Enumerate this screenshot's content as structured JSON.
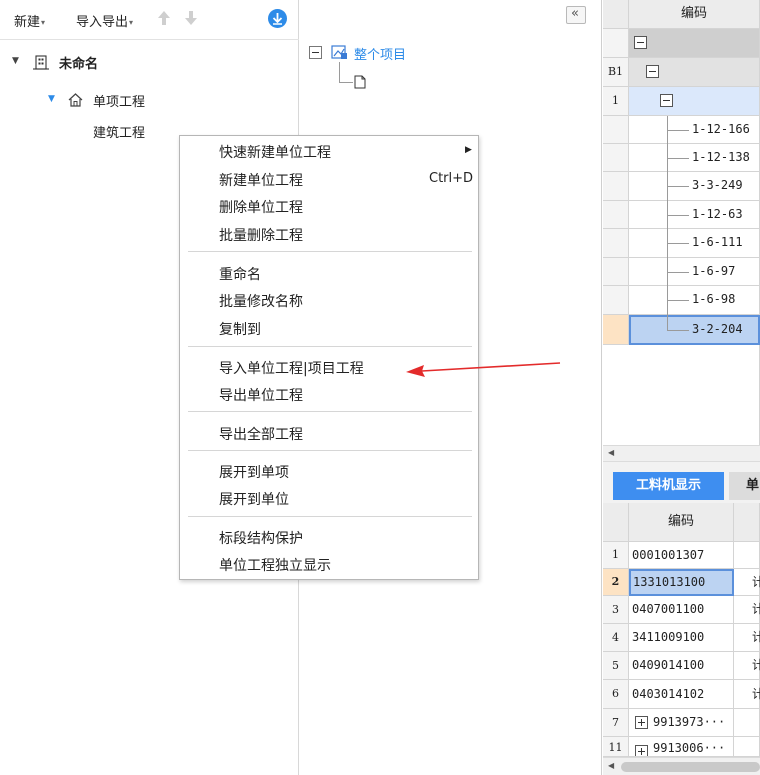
{
  "toolbar": {
    "new_label": "新建",
    "import_export_label": "导入导出"
  },
  "tree": {
    "root_label": "未命名",
    "project_label": "单项工程",
    "unit_label": "建筑工程"
  },
  "middle": {
    "whole_project_label": "整个项目",
    "collapse_glyph": "«"
  },
  "context_menu": {
    "items": [
      {
        "label": "快速新建单位工程",
        "has_submenu": true
      },
      {
        "label": "新建单位工程",
        "shortcut": "Ctrl+D"
      },
      {
        "label": "删除单位工程"
      },
      {
        "label": "批量删除工程"
      },
      {
        "label": "重命名"
      },
      {
        "label": "批量修改名称"
      },
      {
        "label": "复制到"
      },
      {
        "label": "导入单位工程|项目工程"
      },
      {
        "label": "导出单位工程"
      },
      {
        "label": "导出全部工程"
      },
      {
        "label": "展开到单项"
      },
      {
        "label": "展开到单位"
      },
      {
        "label": "标段结构保护"
      },
      {
        "label": "单位工程独立显示"
      }
    ]
  },
  "top_grid": {
    "header": "编码",
    "row_labels": [
      "B1",
      "1"
    ],
    "codes": [
      "1-12-166",
      "1-12-138",
      "3-3-249",
      "1-12-63",
      "1-6-111",
      "1-6-97",
      "1-6-98",
      "3-2-204"
    ]
  },
  "bottom_tabs": {
    "active": "工料机显示",
    "second": "单"
  },
  "bottom_grid": {
    "header": "编码",
    "rows": [
      {
        "num": "1",
        "code": "0001001307",
        "extra": ""
      },
      {
        "num": "2",
        "code": "1331013100",
        "extra": "计"
      },
      {
        "num": "3",
        "code": "0407001100",
        "extra": "计"
      },
      {
        "num": "4",
        "code": "3411009100",
        "extra": "计"
      },
      {
        "num": "5",
        "code": "0409014100",
        "extra": "计"
      },
      {
        "num": "6",
        "code": "0403014102",
        "extra": "计"
      },
      {
        "num": "7",
        "code": "9913973···",
        "extra": ""
      },
      {
        "num": "11",
        "code": "9913006···",
        "extra": ""
      }
    ]
  },
  "colors": {
    "accent_blue": "#2d8be8",
    "tab_blue": "#3e8ef0",
    "selected_row": "#cfe0f7",
    "highlight_row": "#fde3c4",
    "annotation_red": "#e32b2b"
  }
}
